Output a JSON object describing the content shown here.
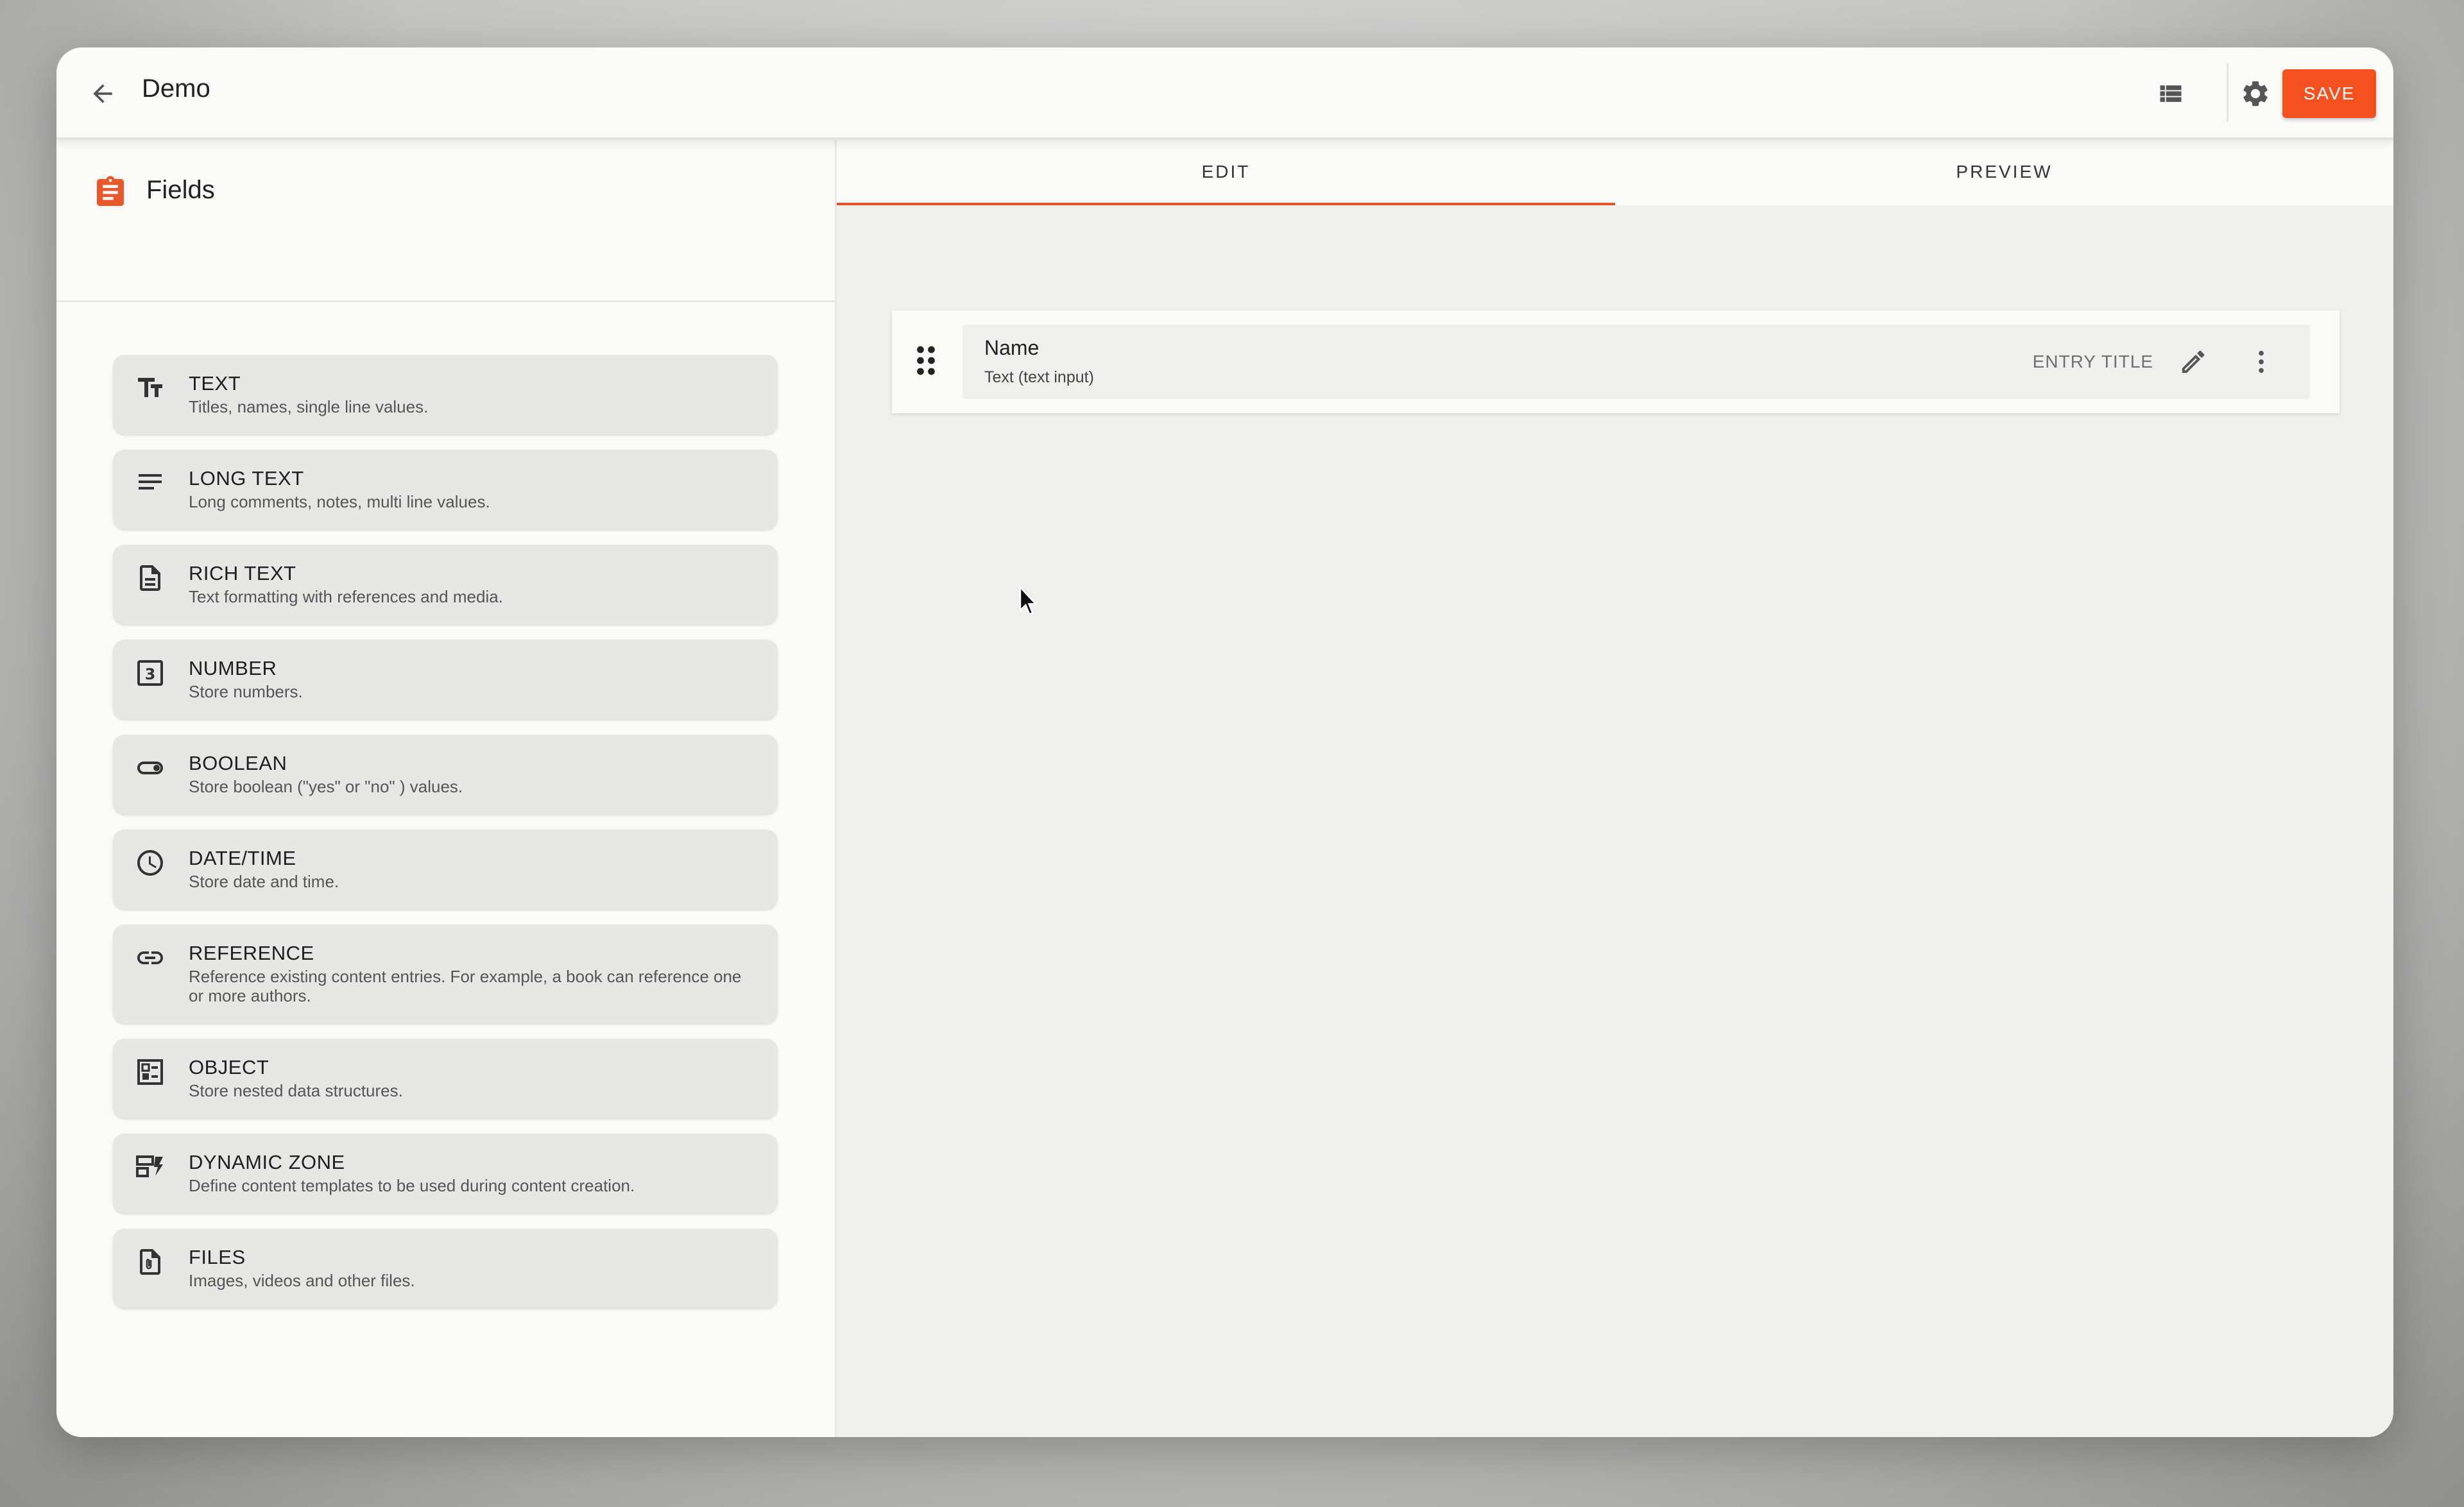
{
  "header": {
    "title": "Demo",
    "save_label": "SAVE",
    "back_icon": "arrow-back-icon",
    "list_icon": "list-view-icon",
    "settings_icon": "gear-icon"
  },
  "sidebar": {
    "title": "Fields",
    "icon": "clipboard-icon",
    "items": [
      {
        "name": "TEXT",
        "desc": "Titles, names, single line values.",
        "icon": "text-format-icon"
      },
      {
        "name": "LONG TEXT",
        "desc": "Long comments, notes, multi line values.",
        "icon": "lines-icon"
      },
      {
        "name": "RICH TEXT",
        "desc": "Text formatting with references and media.",
        "icon": "document-icon"
      },
      {
        "name": "NUMBER",
        "desc": "Store numbers.",
        "icon": "number-icon"
      },
      {
        "name": "BOOLEAN",
        "desc": "Store boolean (\"yes\" or \"no\" ) values.",
        "icon": "toggle-icon"
      },
      {
        "name": "DATE/TIME",
        "desc": "Store date and time.",
        "icon": "clock-icon"
      },
      {
        "name": "REFERENCE",
        "desc": "Reference existing content entries. For example, a book can reference one or more authors.",
        "icon": "link-icon"
      },
      {
        "name": "OBJECT",
        "desc": "Store nested data structures.",
        "icon": "object-icon"
      },
      {
        "name": "DYNAMIC ZONE",
        "desc": "Define content templates to be used during content creation.",
        "icon": "dynamic-zone-icon"
      },
      {
        "name": "FILES",
        "desc": "Images, videos and other files.",
        "icon": "file-icon"
      }
    ]
  },
  "tabs": [
    {
      "label": "EDIT",
      "active": true
    },
    {
      "label": "PREVIEW",
      "active": false
    }
  ],
  "entry": {
    "name": "Name",
    "type": "Text (text input)",
    "badge": "ENTRY TITLE"
  },
  "colors": {
    "accent": "#f4511e",
    "tab_indicator": "#e0552a"
  }
}
